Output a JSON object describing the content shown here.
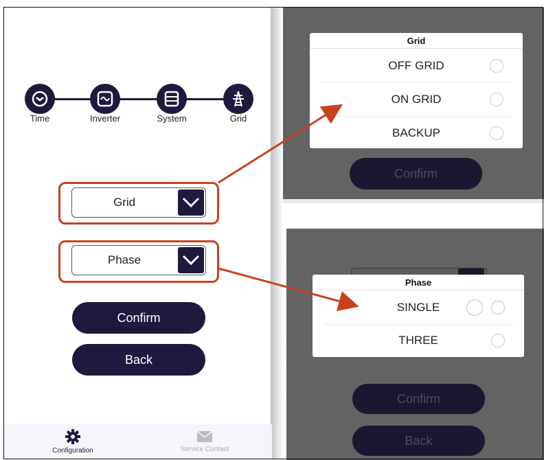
{
  "steps": [
    {
      "label": "Time",
      "icon": "clock-icon"
    },
    {
      "label": "Inverter",
      "icon": "inverter-icon"
    },
    {
      "label": "System",
      "icon": "system-icon"
    },
    {
      "label": "Grid",
      "icon": "transmission-tower-icon"
    }
  ],
  "form": {
    "grid_select": "Grid",
    "phase_select": "Phase",
    "confirm_label": "Confirm",
    "back_label": "Back"
  },
  "bottom_nav": [
    {
      "label": "Configuration",
      "icon": "gear-icon",
      "active": true
    },
    {
      "label": "Service Contact",
      "icon": "mail-icon",
      "active": false
    }
  ],
  "grid_popup": {
    "title": "Grid",
    "options": [
      "OFF GRID",
      "ON GRID",
      "BACKUP"
    ],
    "confirm_label": "Confirm"
  },
  "phase_popup": {
    "title": "Phase",
    "options": [
      "SINGLE",
      "THREE"
    ],
    "confirm_label": "Confirm",
    "back_label": "Back"
  },
  "colors": {
    "primary": "#1e1a3d",
    "highlight": "#c6431f",
    "overlay": "#636363"
  }
}
